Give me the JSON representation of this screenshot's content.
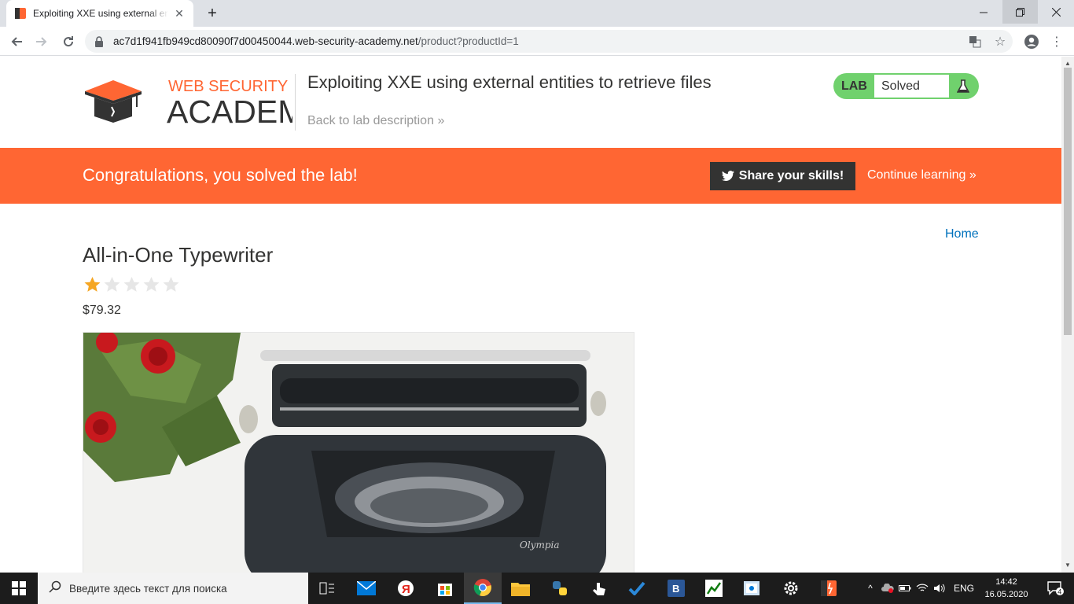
{
  "browser": {
    "tab_title": "Exploiting XXE using external entities to retrieve files",
    "new_tab": "+",
    "url_host": "ac7d1f941fb949cd80090f7d00450044.web-security-academy.net",
    "url_path": "/product?productId=1"
  },
  "header": {
    "logo_line1": "WEB SECURITY",
    "logo_line2": "ACADEMY",
    "lab_title": "Exploiting XXE using external entities to retrieve files",
    "back_link": "Back to lab description",
    "lab_label": "LAB",
    "lab_status": "Solved"
  },
  "banner": {
    "congrats": "Congratulations, you solved the lab!",
    "share_label": "Share your skills!",
    "continue_label": "Continue learning"
  },
  "product": {
    "home_link": "Home",
    "title": "All-in-One Typewriter",
    "rating": 1,
    "rating_max": 5,
    "price": "$79.32"
  },
  "taskbar": {
    "search_placeholder": "Введите здесь текст для поиска",
    "language": "ENG",
    "time": "14:42",
    "date": "16.05.2020",
    "notifications": "4"
  },
  "colors": {
    "accent": "#ff6633",
    "lab_green": "#70d16d",
    "link_blue": "#0071bc"
  }
}
